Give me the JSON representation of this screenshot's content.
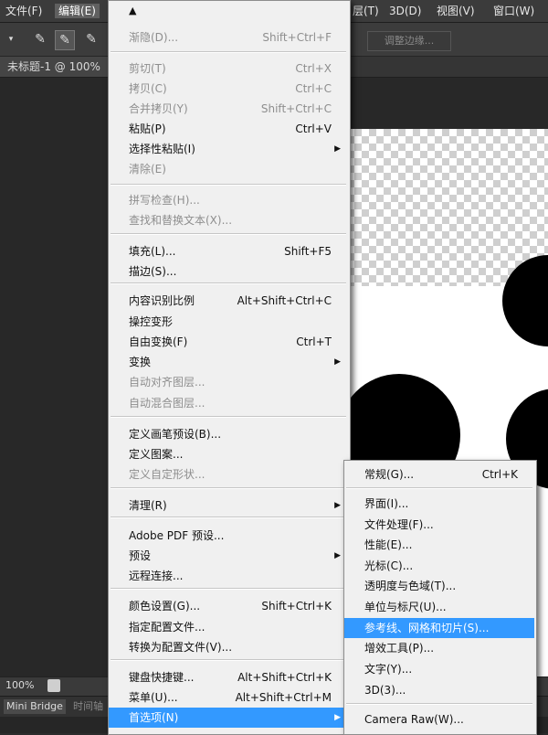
{
  "menubar": {
    "file": "文件(F)",
    "edit": "编辑(E)",
    "layer_partial": "层(T)",
    "three_d": "3D(D)",
    "view": "视图(V)",
    "window": "窗口(W)"
  },
  "optbar": {
    "refine_edge": "调整边缘..."
  },
  "tab": {
    "doc_title": "未标题-1 @ 100%"
  },
  "status": {
    "zoom": "100%"
  },
  "bottom": {
    "tab1": "Mini Bridge",
    "tab2": "时间轴"
  },
  "edit_menu": {
    "up_arrow": "▲",
    "items": [
      {
        "label": "渐隐(D)...",
        "shortcut": "Shift+Ctrl+F",
        "disabled": true
      },
      {
        "label": "剪切(T)",
        "shortcut": "Ctrl+X",
        "disabled": true
      },
      {
        "label": "拷贝(C)",
        "shortcut": "Ctrl+C",
        "disabled": true
      },
      {
        "label": "合并拷贝(Y)",
        "shortcut": "Shift+Ctrl+C",
        "disabled": true
      },
      {
        "label": "粘贴(P)",
        "shortcut": "Ctrl+V",
        "disabled": false
      },
      {
        "label": "选择性粘贴(I)",
        "shortcut": "",
        "disabled": false,
        "submenu": true
      },
      {
        "label": "清除(E)",
        "shortcut": "",
        "disabled": true
      },
      {
        "label": "拼写检查(H)...",
        "shortcut": "",
        "disabled": true
      },
      {
        "label": "查找和替换文本(X)...",
        "shortcut": "",
        "disabled": true
      },
      {
        "label": "填充(L)...",
        "shortcut": "Shift+F5",
        "disabled": false
      },
      {
        "label": "描边(S)...",
        "shortcut": "",
        "disabled": false
      },
      {
        "label": "内容识别比例",
        "shortcut": "Alt+Shift+Ctrl+C",
        "disabled": false
      },
      {
        "label": "操控变形",
        "shortcut": "",
        "disabled": false
      },
      {
        "label": "自由变换(F)",
        "shortcut": "Ctrl+T",
        "disabled": false
      },
      {
        "label": "变换",
        "shortcut": "",
        "disabled": false,
        "submenu": true
      },
      {
        "label": "自动对齐图层...",
        "shortcut": "",
        "disabled": true
      },
      {
        "label": "自动混合图层...",
        "shortcut": "",
        "disabled": true
      },
      {
        "label": "定义画笔预设(B)...",
        "shortcut": "",
        "disabled": false
      },
      {
        "label": "定义图案...",
        "shortcut": "",
        "disabled": false
      },
      {
        "label": "定义自定形状...",
        "shortcut": "",
        "disabled": true
      },
      {
        "label": "清理(R)",
        "shortcut": "",
        "disabled": false,
        "submenu": true
      },
      {
        "label": "Adobe PDF 预设...",
        "shortcut": "",
        "disabled": false
      },
      {
        "label": "预设",
        "shortcut": "",
        "disabled": false,
        "submenu": true
      },
      {
        "label": "远程连接...",
        "shortcut": "",
        "disabled": false
      },
      {
        "label": "颜色设置(G)...",
        "shortcut": "Shift+Ctrl+K",
        "disabled": false
      },
      {
        "label": "指定配置文件...",
        "shortcut": "",
        "disabled": false
      },
      {
        "label": "转换为配置文件(V)...",
        "shortcut": "",
        "disabled": false
      },
      {
        "label": "键盘快捷键...",
        "shortcut": "Alt+Shift+Ctrl+K",
        "disabled": false
      },
      {
        "label": "菜单(U)...",
        "shortcut": "Alt+Shift+Ctrl+M",
        "disabled": false
      },
      {
        "label": "首选项(N)",
        "shortcut": "",
        "disabled": false,
        "submenu": true,
        "highlighted": true
      }
    ]
  },
  "prefs_submenu": {
    "items": [
      {
        "label": "常规(G)...",
        "shortcut": "Ctrl+K"
      },
      {
        "label": "界面(I)..."
      },
      {
        "label": "文件处理(F)..."
      },
      {
        "label": "性能(E)..."
      },
      {
        "label": "光标(C)..."
      },
      {
        "label": "透明度与色域(T)..."
      },
      {
        "label": "单位与标尺(U)..."
      },
      {
        "label": "参考线、网格和切片(S)...",
        "highlighted": true
      },
      {
        "label": "增效工具(P)..."
      },
      {
        "label": "文字(Y)..."
      },
      {
        "label": "3D(3)..."
      },
      {
        "label": "Camera Raw(W)..."
      }
    ]
  }
}
